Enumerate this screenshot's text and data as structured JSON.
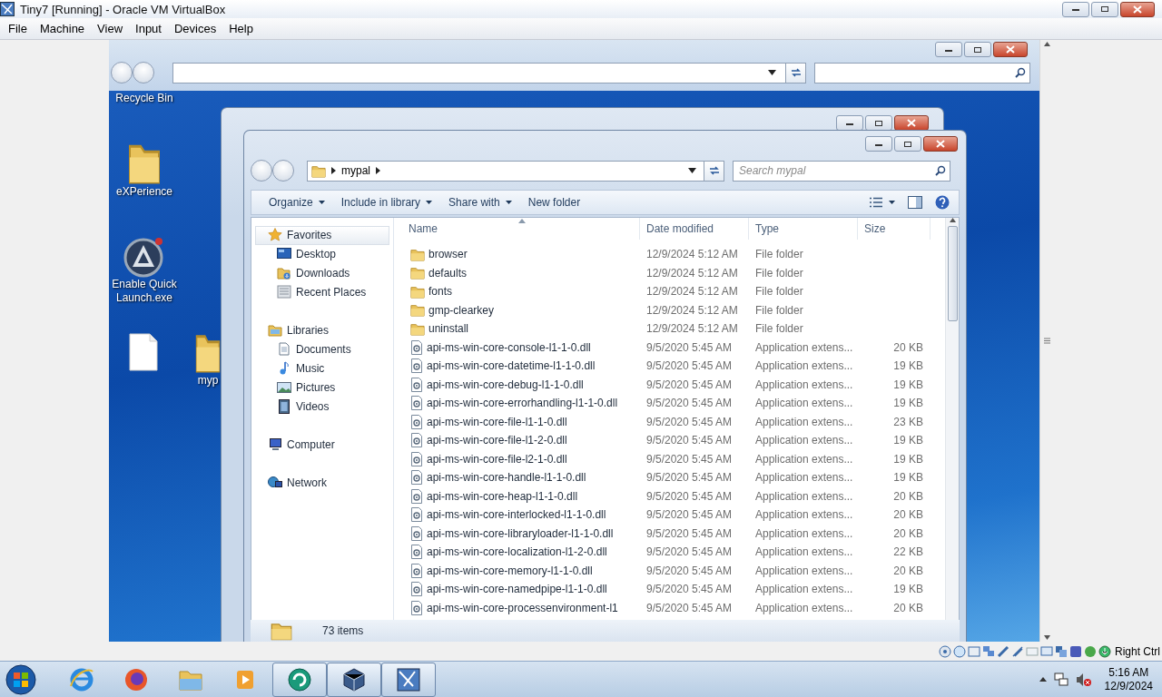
{
  "host_window": {
    "title": "Tiny7 [Running] - Oracle VM VirtualBox"
  },
  "menu_bar": [
    "File",
    "Machine",
    "View",
    "Input",
    "Devices",
    "Help"
  ],
  "desktop_icons": [
    {
      "label": "Recycle Bin",
      "kind": "label_only"
    },
    {
      "label": "eXPerience",
      "kind": "folder"
    },
    {
      "label": "Enable Quick Launch.exe",
      "kind": "app"
    },
    {
      "kind": "file"
    },
    {
      "label": "myp",
      "kind": "folder"
    }
  ],
  "explorer": {
    "breadcrumb": [
      "mypal"
    ],
    "search": {
      "placeholder": "Search mypal"
    },
    "toolbar": [
      {
        "label": "Organize",
        "dropdown": true
      },
      {
        "label": "Include in library",
        "dropdown": true
      },
      {
        "label": "Share with",
        "dropdown": true
      },
      {
        "label": "New folder",
        "dropdown": false
      }
    ],
    "nav_pane": [
      {
        "label": "Favorites",
        "kind": "star",
        "selected": true,
        "children": [
          {
            "label": "Desktop",
            "kind": "desktop",
            "selected": false
          },
          {
            "label": "Downloads",
            "kind": "downloads",
            "selected": false
          },
          {
            "label": "Recent Places",
            "kind": "recent",
            "selected": false
          }
        ]
      },
      {
        "label": "Libraries",
        "kind": "libraries",
        "selected": false,
        "children": [
          {
            "label": "Documents",
            "kind": "documents",
            "selected": false
          },
          {
            "label": "Music",
            "kind": "music",
            "selected": false
          },
          {
            "label": "Pictures",
            "kind": "pictures",
            "selected": false
          },
          {
            "label": "Videos",
            "kind": "videos",
            "selected": false
          }
        ]
      },
      {
        "label": "Computer",
        "kind": "computer",
        "selected": false
      },
      {
        "label": "Network",
        "kind": "network",
        "selected": false
      }
    ],
    "columns": [
      "Name",
      "Date modified",
      "Type",
      "Size"
    ],
    "rows": [
      {
        "kind": "folder",
        "name": "browser",
        "date": "12/9/2024 5:12 AM",
        "type": "File folder"
      },
      {
        "kind": "folder",
        "name": "defaults",
        "date": "12/9/2024 5:12 AM",
        "type": "File folder"
      },
      {
        "kind": "folder",
        "name": "fonts",
        "date": "12/9/2024 5:12 AM",
        "type": "File folder"
      },
      {
        "kind": "folder",
        "name": "gmp-clearkey",
        "date": "12/9/2024 5:12 AM",
        "type": "File folder"
      },
      {
        "kind": "folder",
        "name": "uninstall",
        "date": "12/9/2024 5:12 AM",
        "type": "File folder"
      },
      {
        "kind": "dll",
        "name": "api-ms-win-core-console-l1-1-0.dll",
        "date": "9/5/2020 5:45 AM",
        "type": "Application extens...",
        "size": "20 KB"
      },
      {
        "kind": "dll",
        "name": "api-ms-win-core-datetime-l1-1-0.dll",
        "date": "9/5/2020 5:45 AM",
        "type": "Application extens...",
        "size": "19 KB"
      },
      {
        "kind": "dll",
        "name": "api-ms-win-core-debug-l1-1-0.dll",
        "date": "9/5/2020 5:45 AM",
        "type": "Application extens...",
        "size": "19 KB"
      },
      {
        "kind": "dll",
        "name": "api-ms-win-core-errorhandling-l1-1-0.dll",
        "date": "9/5/2020 5:45 AM",
        "type": "Application extens...",
        "size": "19 KB"
      },
      {
        "kind": "dll",
        "name": "api-ms-win-core-file-l1-1-0.dll",
        "date": "9/5/2020 5:45 AM",
        "type": "Application extens...",
        "size": "23 KB"
      },
      {
        "kind": "dll",
        "name": "api-ms-win-core-file-l1-2-0.dll",
        "date": "9/5/2020 5:45 AM",
        "type": "Application extens...",
        "size": "19 KB"
      },
      {
        "kind": "dll",
        "name": "api-ms-win-core-file-l2-1-0.dll",
        "date": "9/5/2020 5:45 AM",
        "type": "Application extens...",
        "size": "19 KB"
      },
      {
        "kind": "dll",
        "name": "api-ms-win-core-handle-l1-1-0.dll",
        "date": "9/5/2020 5:45 AM",
        "type": "Application extens...",
        "size": "19 KB"
      },
      {
        "kind": "dll",
        "name": "api-ms-win-core-heap-l1-1-0.dll",
        "date": "9/5/2020 5:45 AM",
        "type": "Application extens...",
        "size": "20 KB"
      },
      {
        "kind": "dll",
        "name": "api-ms-win-core-interlocked-l1-1-0.dll",
        "date": "9/5/2020 5:45 AM",
        "type": "Application extens...",
        "size": "20 KB"
      },
      {
        "kind": "dll",
        "name": "api-ms-win-core-libraryloader-l1-1-0.dll",
        "date": "9/5/2020 5:45 AM",
        "type": "Application extens...",
        "size": "20 KB"
      },
      {
        "kind": "dll",
        "name": "api-ms-win-core-localization-l1-2-0.dll",
        "date": "9/5/2020 5:45 AM",
        "type": "Application extens...",
        "size": "22 KB"
      },
      {
        "kind": "dll",
        "name": "api-ms-win-core-memory-l1-1-0.dll",
        "date": "9/5/2020 5:45 AM",
        "type": "Application extens...",
        "size": "20 KB"
      },
      {
        "kind": "dll",
        "name": "api-ms-win-core-namedpipe-l1-1-0.dll",
        "date": "9/5/2020 5:45 AM",
        "type": "Application extens...",
        "size": "19 KB"
      },
      {
        "kind": "dll",
        "name": "api-ms-win-core-processenvironment-l1",
        "date": "9/5/2020 5:45 AM",
        "type": "Application extens...",
        "size": "20 KB"
      }
    ],
    "status": "73 items"
  },
  "vbox_status": {
    "host_key": "Right Ctrl"
  },
  "taskbar": {
    "apps": [
      {
        "kind": "ie",
        "running": false
      },
      {
        "kind": "firefox",
        "running": false
      },
      {
        "kind": "explorer",
        "running": false
      },
      {
        "kind": "media",
        "running": false
      },
      {
        "kind": "vm",
        "running": true
      },
      {
        "kind": "virtualbox",
        "running": true
      },
      {
        "kind": "tiny7",
        "running": true
      }
    ],
    "clock": {
      "time": "5:16 AM",
      "date": "12/9/2024"
    }
  }
}
